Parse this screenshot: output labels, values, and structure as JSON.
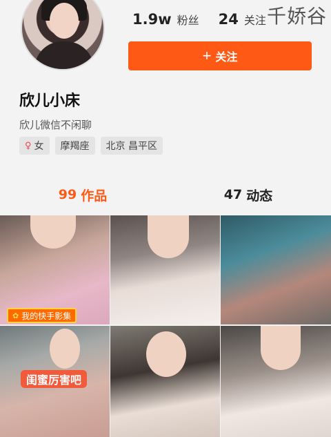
{
  "profile": {
    "name": "欣儿小床",
    "bio": "欣儿微信不闲聊",
    "stats": [
      {
        "value": "1.9w",
        "label": "粉丝"
      },
      {
        "value": "24",
        "label": "关注"
      }
    ],
    "follow_label": "关注",
    "tags": [
      {
        "icon": "female-icon",
        "label": "女"
      },
      {
        "label": "摩羯座"
      },
      {
        "label": "北京 昌平区"
      }
    ]
  },
  "watermark": "千娇谷",
  "tabs": [
    {
      "count": "99",
      "label": "作品",
      "active": true
    },
    {
      "count": "47",
      "label": "动态",
      "active": false
    }
  ],
  "grid": {
    "collection_badge": "我的快手影集",
    "caption": "闺蜜厉害吧"
  },
  "colors": {
    "accent": "#fe5a16",
    "background": "#f3f3f3"
  }
}
